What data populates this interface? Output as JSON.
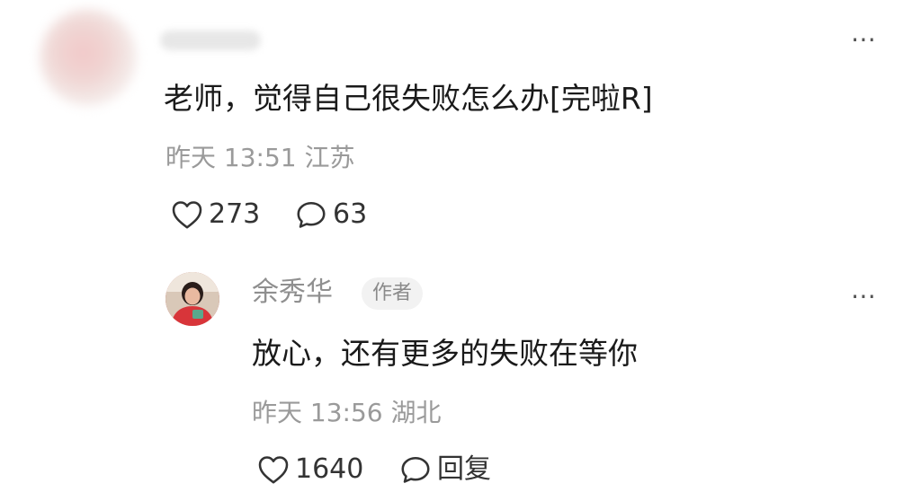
{
  "comment": {
    "text": "老师，觉得自己很失败怎么办[完啦R]",
    "meta": "昨天 13:51 江苏",
    "likes": "273",
    "replies": "63",
    "more_icon": "⋯"
  },
  "reply": {
    "username": "余秀华",
    "badge": "作者",
    "text": "放心，还有更多的失败在等你",
    "meta": "昨天 13:56 湖北",
    "likes": "1640",
    "reply_label": "回复",
    "more_icon": "⋯"
  },
  "colors": {
    "text": "#1a1a1a",
    "meta": "#9a9a9a",
    "username": "#8f8f8f",
    "badge_bg": "#f2f2f2"
  },
  "icons": {
    "like": "heart-outline-icon",
    "comment": "speech-bubble-icon",
    "more": "ellipsis-icon"
  }
}
